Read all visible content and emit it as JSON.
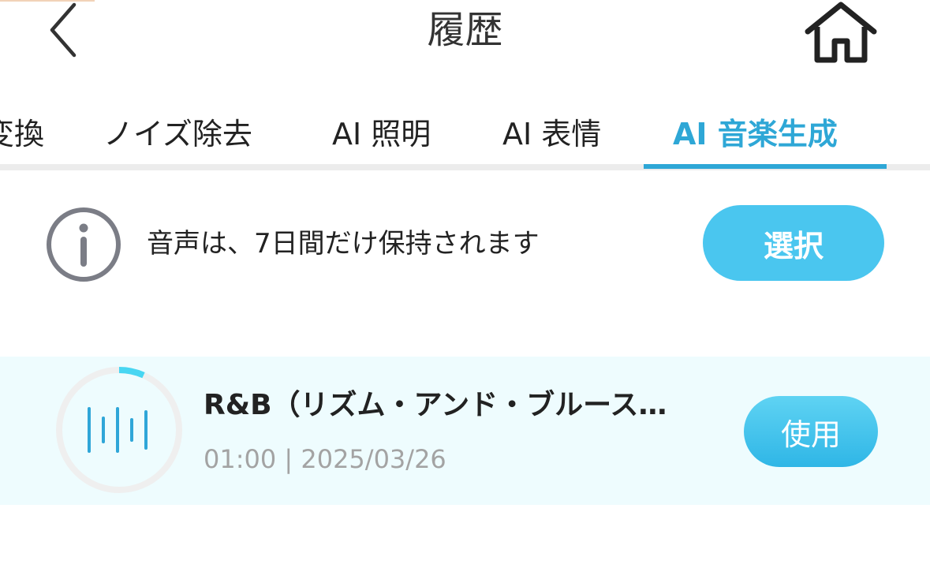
{
  "header": {
    "title": "履歴",
    "back_icon": "chevron-left-icon",
    "home_icon": "home-icon"
  },
  "tabs": [
    {
      "label": "変換",
      "active": false
    },
    {
      "label": "ノイズ除去",
      "active": false
    },
    {
      "label": "AI 照明",
      "active": false
    },
    {
      "label": "AI 表情",
      "active": false
    },
    {
      "label": "AI 音楽生成",
      "active": true
    }
  ],
  "info": {
    "icon": "info-icon",
    "text": "音声は、7日間だけ保持されます",
    "select_label": "選択"
  },
  "history": [
    {
      "title": "R&B（リズム・アンド・ブルース…",
      "meta": "01:00 | 2025/03/26",
      "use_label": "使用",
      "icon": "audio-wave-icon"
    }
  ],
  "colors": {
    "accent": "#2ea7d6",
    "button": "#4ac6ef",
    "item_background": "#eefcfe",
    "muted_text": "#a3a3a3"
  }
}
